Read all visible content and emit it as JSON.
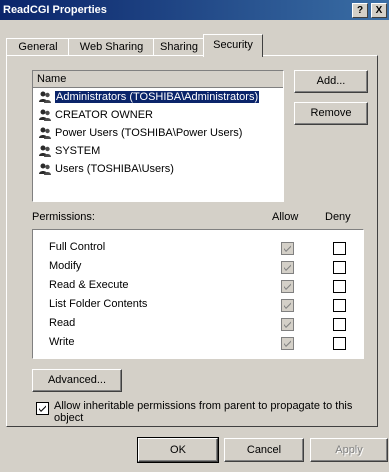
{
  "window": {
    "title": "ReadCGI Properties",
    "help_btn": "?",
    "close_btn": "X"
  },
  "tabs": [
    {
      "label": "General"
    },
    {
      "label": "Web Sharing"
    },
    {
      "label": "Sharing"
    },
    {
      "label": "Security"
    }
  ],
  "names": {
    "header": "Name",
    "items": [
      {
        "label": "Administrators (TOSHIBA\\Administrators)",
        "selected": true
      },
      {
        "label": "CREATOR OWNER"
      },
      {
        "label": "Power Users (TOSHIBA\\Power Users)"
      },
      {
        "label": "SYSTEM"
      },
      {
        "label": "Users (TOSHIBA\\Users)"
      }
    ]
  },
  "buttons": {
    "add": "Add...",
    "remove": "Remove",
    "advanced": "Advanced...",
    "ok": "OK",
    "cancel": "Cancel",
    "apply": "Apply"
  },
  "permissions": {
    "label": "Permissions:",
    "allow_header": "Allow",
    "deny_header": "Deny",
    "rows": [
      {
        "name": "Full Control",
        "allow": true,
        "deny": false
      },
      {
        "name": "Modify",
        "allow": true,
        "deny": false
      },
      {
        "name": "Read & Execute",
        "allow": true,
        "deny": false
      },
      {
        "name": "List Folder Contents",
        "allow": true,
        "deny": false
      },
      {
        "name": "Read",
        "allow": true,
        "deny": false
      },
      {
        "name": "Write",
        "allow": true,
        "deny": false
      }
    ]
  },
  "inherit": {
    "checked": true,
    "text": "Allow inheritable permissions from parent to propagate to this object"
  },
  "colors": {
    "title_bar": "#0a246a",
    "selection": "#0a246a",
    "face": "#d4d0c8"
  }
}
